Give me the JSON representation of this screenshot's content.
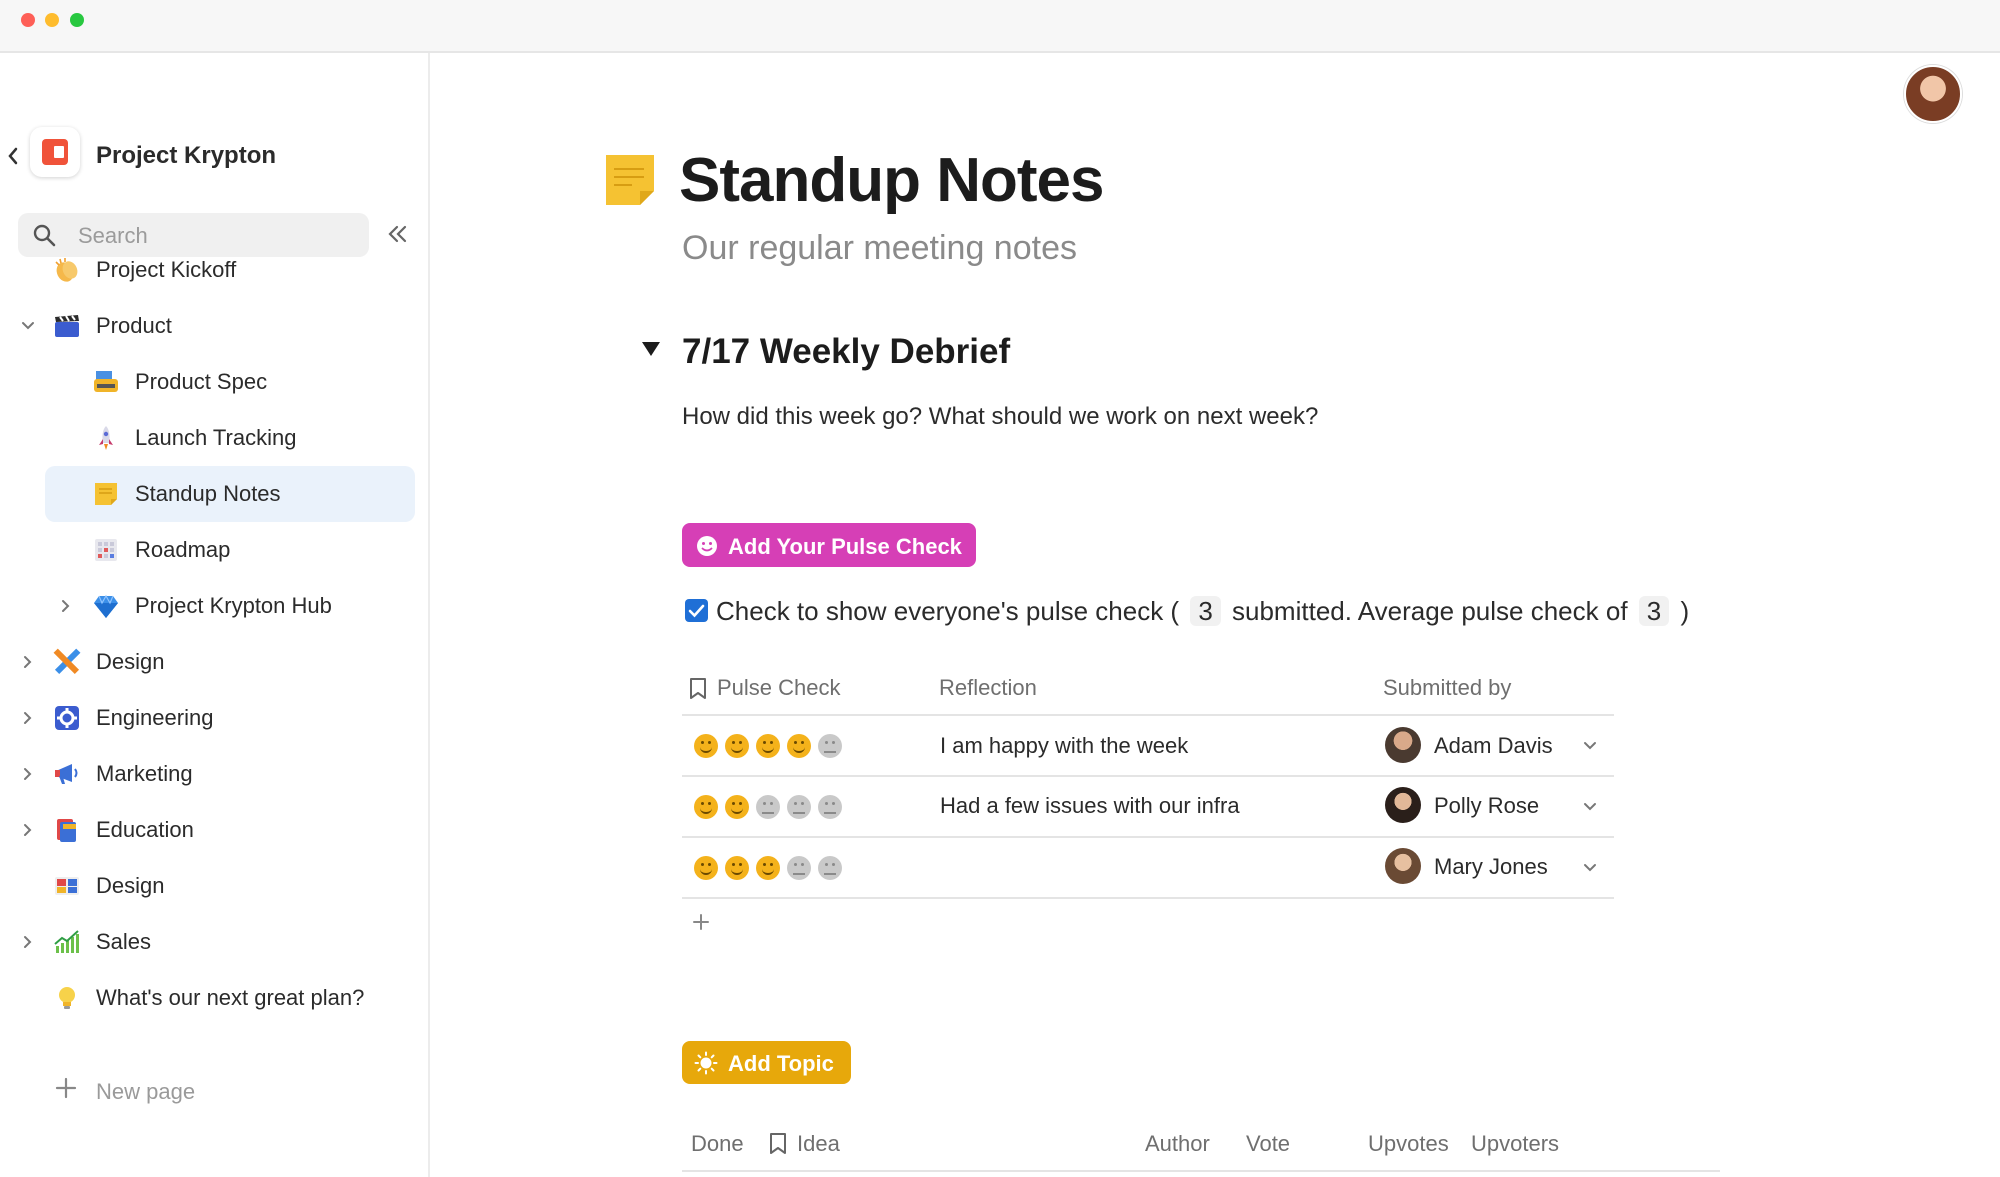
{
  "window": {
    "controls": [
      "close",
      "minimize",
      "zoom"
    ]
  },
  "sidebar": {
    "workspace_title": "Project Krypton",
    "search_placeholder": "Search",
    "items": [
      {
        "label": "Project Kickoff",
        "icon": "clapping-hands-icon",
        "indent": 0,
        "expander": "none"
      },
      {
        "label": "Product",
        "icon": "clapperboard-icon",
        "indent": 0,
        "expander": "expanded"
      },
      {
        "label": "Product Spec",
        "icon": "typewriter-icon",
        "indent": 1,
        "expander": "none"
      },
      {
        "label": "Launch Tracking",
        "icon": "rocket-icon",
        "indent": 1,
        "expander": "none"
      },
      {
        "label": "Standup Notes",
        "icon": "sticky-note-icon",
        "indent": 1,
        "expander": "none",
        "active": true
      },
      {
        "label": "Roadmap",
        "icon": "grid-calendar-icon",
        "indent": 1,
        "expander": "none"
      },
      {
        "label": "Project Krypton Hub",
        "icon": "gem-icon",
        "indent": 1,
        "expander": "collapsed"
      },
      {
        "label": "Design",
        "icon": "pencil-ruler-icon",
        "indent": 0,
        "expander": "collapsed"
      },
      {
        "label": "Engineering",
        "icon": "gear-icon",
        "indent": 0,
        "expander": "collapsed"
      },
      {
        "label": "Marketing",
        "icon": "megaphone-icon",
        "indent": 0,
        "expander": "collapsed"
      },
      {
        "label": "Education",
        "icon": "books-icon",
        "indent": 0,
        "expander": "collapsed"
      },
      {
        "label": "Design",
        "icon": "color-swatch-icon",
        "indent": 0,
        "expander": "none"
      },
      {
        "label": "Sales",
        "icon": "chart-increasing-icon",
        "indent": 0,
        "expander": "collapsed"
      },
      {
        "label": "What's our next great plan?",
        "icon": "light-bulb-icon",
        "indent": 0,
        "expander": "none"
      }
    ],
    "new_page_label": "New page"
  },
  "page": {
    "title": "Standup Notes",
    "subtitle": "Our regular meeting notes",
    "section": {
      "title": "7/17 Weekly Debrief",
      "question": "How did this week go? What should we work on next week?"
    },
    "pulse_button_label": "Add Your Pulse Check",
    "checkbox": {
      "checked": true,
      "text_before": "Check to show everyone's pulse check (",
      "submitted_count": "3",
      "text_middle": "submitted. Average pulse check of",
      "average": "3",
      "text_after": ")"
    },
    "pulse_table": {
      "columns": [
        "Pulse Check",
        "Reflection",
        "Submitted by"
      ],
      "rows": [
        {
          "rating": 4,
          "max": 5,
          "reflection": "I am happy with the week",
          "submitted_by": "Adam Davis"
        },
        {
          "rating": 2,
          "max": 5,
          "reflection": "Had a few issues with our infra",
          "submitted_by": "Polly Rose"
        },
        {
          "rating": 3,
          "max": 5,
          "reflection": "",
          "submitted_by": "Mary Jones"
        }
      ]
    },
    "add_topic_label": "Add Topic",
    "topics_table": {
      "columns": [
        "Done",
        "Idea",
        "Author",
        "Vote",
        "Upvotes",
        "Upvoters"
      ]
    }
  },
  "colors": {
    "pulse_button": "#d63fb6",
    "topic_button": "#e7a80b",
    "active_nav": "#eaf2fb",
    "checkbox": "#1f6fd6"
  }
}
